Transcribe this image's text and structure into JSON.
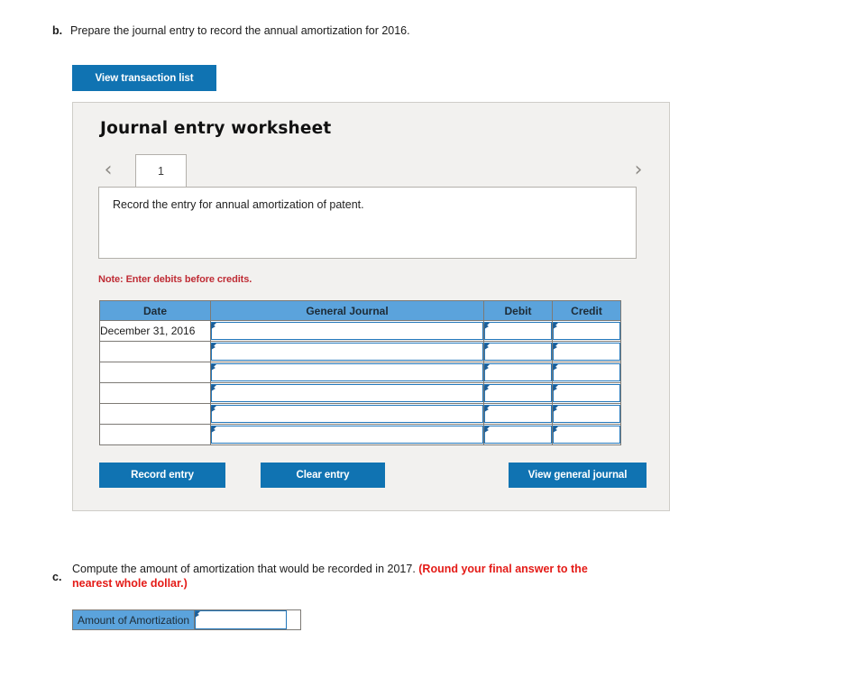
{
  "question_b": {
    "letter": "b.",
    "text": "Prepare the journal entry to record the annual amortization for 2016."
  },
  "toolbar": {
    "view_transaction_list_label": "View transaction list"
  },
  "worksheet": {
    "title": "Journal entry worksheet",
    "tabs": [
      {
        "label": "1",
        "active": true
      }
    ],
    "nav": {
      "prev_icon": "chevron-left-icon",
      "prev_glyph": "‹",
      "next_icon": "chevron-right-icon",
      "next_glyph": "›"
    },
    "instruction": "Record the entry for annual amortization of patent.",
    "note": "Note: Enter debits before credits.",
    "table": {
      "columns": [
        "Date",
        "General Journal",
        "Debit",
        "Credit"
      ],
      "rows": [
        {
          "date": "December 31, 2016",
          "general_journal": "",
          "debit": "",
          "credit": ""
        },
        {
          "date": "",
          "general_journal": "",
          "debit": "",
          "credit": ""
        },
        {
          "date": "",
          "general_journal": "",
          "debit": "",
          "credit": ""
        },
        {
          "date": "",
          "general_journal": "",
          "debit": "",
          "credit": ""
        },
        {
          "date": "",
          "general_journal": "",
          "debit": "",
          "credit": ""
        },
        {
          "date": "",
          "general_journal": "",
          "debit": "",
          "credit": ""
        }
      ]
    },
    "buttons": {
      "record_entry": "Record entry",
      "clear_entry": "Clear entry",
      "view_general_journal": "View general journal"
    }
  },
  "question_c": {
    "letter": "c.",
    "text_plain": "Compute the amount of amortization that would be recorded in 2017. ",
    "text_red": "(Round your final answer to the nearest whole dollar.)",
    "answer_label": "Amount of Amortization",
    "answer_value": ""
  },
  "colors": {
    "button_blue": "#1073b2",
    "header_blue": "#5ba3dc",
    "field_border_blue": "#2176ba",
    "marker_blue": "#1c5f99",
    "note_red": "#bf2c35",
    "emphasis_red": "#e41b17",
    "panel_gray": "#f2f1ef"
  }
}
